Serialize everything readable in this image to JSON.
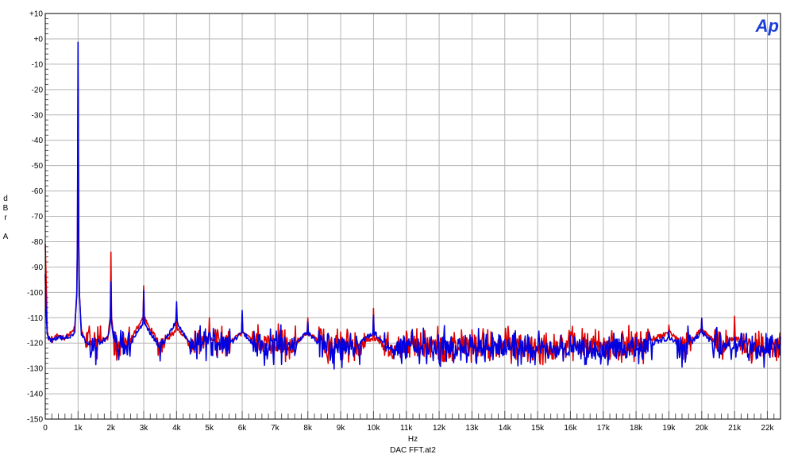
{
  "chart_data": {
    "type": "line",
    "title": "",
    "xlabel": "Hz",
    "ylabel": "dBr A",
    "ylabel_lines": [
      "d",
      "B",
      "r",
      "",
      "A"
    ],
    "footer": "DAC FFT.at2",
    "logo": "Ap",
    "xlim": [
      0,
      22400
    ],
    "ylim": [
      -150,
      10
    ],
    "grid": true,
    "x_ticks": [
      {
        "value": 0,
        "label": "0"
      },
      {
        "value": 1000,
        "label": "1k"
      },
      {
        "value": 2000,
        "label": "2k"
      },
      {
        "value": 3000,
        "label": "3k"
      },
      {
        "value": 4000,
        "label": "4k"
      },
      {
        "value": 5000,
        "label": "5k"
      },
      {
        "value": 6000,
        "label": "6k"
      },
      {
        "value": 7000,
        "label": "7k"
      },
      {
        "value": 8000,
        "label": "8k"
      },
      {
        "value": 9000,
        "label": "9k"
      },
      {
        "value": 10000,
        "label": "10k"
      },
      {
        "value": 11000,
        "label": "11k"
      },
      {
        "value": 12000,
        "label": "12k"
      },
      {
        "value": 13000,
        "label": "13k"
      },
      {
        "value": 14000,
        "label": "14k"
      },
      {
        "value": 15000,
        "label": "15k"
      },
      {
        "value": 16000,
        "label": "16k"
      },
      {
        "value": 17000,
        "label": "17k"
      },
      {
        "value": 18000,
        "label": "18k"
      },
      {
        "value": 19000,
        "label": "19k"
      },
      {
        "value": 20000,
        "label": "20k"
      },
      {
        "value": 21000,
        "label": "21k"
      },
      {
        "value": 22000,
        "label": "22k"
      }
    ],
    "y_ticks": [
      {
        "value": 10,
        "label": "+10"
      },
      {
        "value": 0,
        "label": "+0"
      },
      {
        "value": -10,
        "label": "-10"
      },
      {
        "value": -20,
        "label": "-20"
      },
      {
        "value": -30,
        "label": "-30"
      },
      {
        "value": -40,
        "label": "-40"
      },
      {
        "value": -50,
        "label": "-50"
      },
      {
        "value": -60,
        "label": "-60"
      },
      {
        "value": -70,
        "label": "-70"
      },
      {
        "value": -80,
        "label": "-80"
      },
      {
        "value": -90,
        "label": "-90"
      },
      {
        "value": -100,
        "label": "-100"
      },
      {
        "value": -110,
        "label": "-110"
      },
      {
        "value": -120,
        "label": "-120"
      },
      {
        "value": -130,
        "label": "-130"
      },
      {
        "value": -140,
        "label": "-140"
      },
      {
        "value": -150,
        "label": "-150"
      }
    ],
    "series": [
      {
        "color": "#e00000",
        "noise_floor_db": -121,
        "x": [
          0,
          30,
          60,
          100,
          200,
          400,
          600,
          800,
          900,
          960,
          980,
          990,
          1000,
          1010,
          1020,
          1040,
          1100,
          1200,
          1500,
          1900,
          1980,
          2000,
          2020,
          2100,
          2500,
          2980,
          3000,
          3020,
          3500,
          3980,
          4000,
          4020,
          4500,
          4980,
          5000,
          5020,
          5500,
          5980,
          6000,
          6020,
          6500,
          7000,
          7500,
          7980,
          8000,
          8020,
          8500,
          9000,
          9500,
          9980,
          10000,
          10020,
          10500,
          11000,
          12000,
          13000,
          14000,
          15000,
          16000,
          17000,
          18000,
          18980,
          19000,
          19020,
          19500,
          19980,
          20000,
          20020,
          20500,
          20980,
          21000,
          21020,
          21500,
          22000,
          22400
        ],
        "y": [
          -80,
          -95,
          -116,
          -118,
          -119,
          -117,
          -118,
          -116,
          -114,
          -100,
          -82,
          -40,
          -17,
          -40,
          -82,
          -100,
          -115,
          -119,
          -120,
          -118,
          -110,
          -84,
          -110,
          -119,
          -121,
          -110,
          -97,
          -110,
          -121,
          -115,
          -106,
          -115,
          -121,
          -118,
          -110,
          -118,
          -121,
          -116,
          -111,
          -116,
          -121,
          -120,
          -121,
          -116,
          -110,
          -116,
          -121,
          -121,
          -120,
          -118,
          -107,
          -118,
          -121,
          -121,
          -121,
          -121,
          -121,
          -121,
          -121,
          -121,
          -121,
          -116,
          -112,
          -116,
          -121,
          -115,
          -110,
          -115,
          -121,
          -118,
          -110,
          -118,
          -121,
          -121,
          -121
        ]
      },
      {
        "color": "#0000e0",
        "noise_floor_db": -122,
        "x": [
          0,
          30,
          60,
          100,
          200,
          400,
          600,
          800,
          900,
          960,
          980,
          990,
          1000,
          1010,
          1020,
          1040,
          1100,
          1200,
          1500,
          1900,
          1980,
          2000,
          2020,
          2100,
          2500,
          2980,
          3000,
          3020,
          3500,
          3980,
          4000,
          4020,
          4500,
          4980,
          5000,
          5020,
          5500,
          5980,
          6000,
          6020,
          6500,
          7000,
          7500,
          7980,
          8000,
          8020,
          8500,
          9000,
          9500,
          9980,
          10000,
          10020,
          10500,
          11000,
          12000,
          13000,
          14000,
          15000,
          16000,
          17000,
          18000,
          18980,
          19000,
          19020,
          19500,
          19980,
          20000,
          20020,
          20500,
          20980,
          21000,
          21020,
          21500,
          22000,
          22400
        ],
        "y": [
          -92,
          -110,
          -117,
          -118,
          -119,
          -118,
          -118,
          -117,
          -115,
          -100,
          -80,
          -30,
          -1,
          -30,
          -80,
          -100,
          -116,
          -119,
          -121,
          -118,
          -112,
          -95,
          -112,
          -120,
          -122,
          -112,
          -100,
          -112,
          -122,
          -112,
          -104,
          -112,
          -122,
          -120,
          -115,
          -120,
          -122,
          -116,
          -108,
          -116,
          -122,
          -121,
          -122,
          -116,
          -111,
          -116,
          -122,
          -122,
          -121,
          -116,
          -109,
          -116,
          -122,
          -122,
          -122,
          -122,
          -122,
          -122,
          -122,
          -122,
          -122,
          -118,
          -116,
          -118,
          -122,
          -116,
          -111,
          -116,
          -122,
          -120,
          -118,
          -120,
          -122,
          -122,
          -122
        ]
      }
    ]
  }
}
